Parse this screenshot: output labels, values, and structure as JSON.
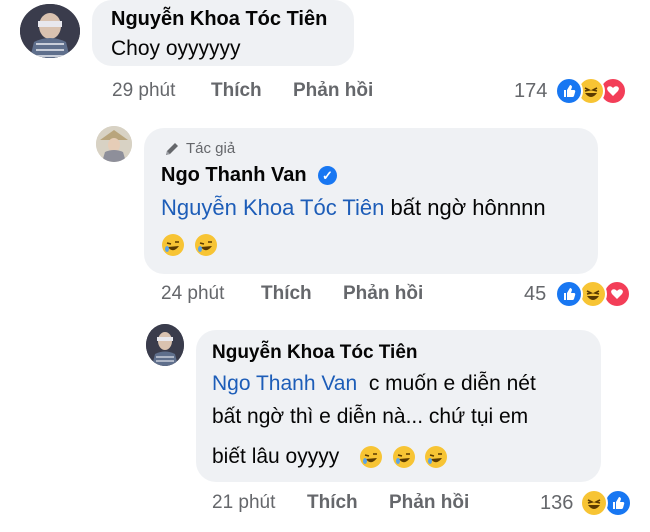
{
  "comment_main": {
    "author": "Nguyễn Khoa Tóc Tiên",
    "text": "Choy oyyyyyy",
    "time": "29 phút",
    "like_label": "Thích",
    "reply_label": "Phản hồi",
    "reaction_count": "174",
    "reactions": [
      "like",
      "haha",
      "love"
    ]
  },
  "reply_van": {
    "author_badge": "Tác giả",
    "author": "Ngo Thanh Van",
    "mention": "Nguyễn Khoa Tóc Tiên",
    "text": "bất ngờ hônnnn",
    "emoji": [
      "rofl",
      "rofl"
    ],
    "time": "24 phút",
    "like_label": "Thích",
    "reply_label": "Phản hồi",
    "reaction_count": "45",
    "reactions": [
      "like",
      "haha",
      "love"
    ]
  },
  "reply_tien": {
    "author": "Nguyễn Khoa Tóc Tiên",
    "mention": "Ngo Thanh Van",
    "line1": "c muốn e diễn nét",
    "line2": "bất ngờ thì e diễn nà... chứ tụi em",
    "line3": "biết lâu oyyyy",
    "emoji": [
      "rofl",
      "rofl",
      "rofl"
    ],
    "time": "21 phút",
    "like_label": "Thích",
    "reply_label": "Phản hồi",
    "reaction_count": "136",
    "reactions": [
      "haha",
      "like"
    ]
  }
}
